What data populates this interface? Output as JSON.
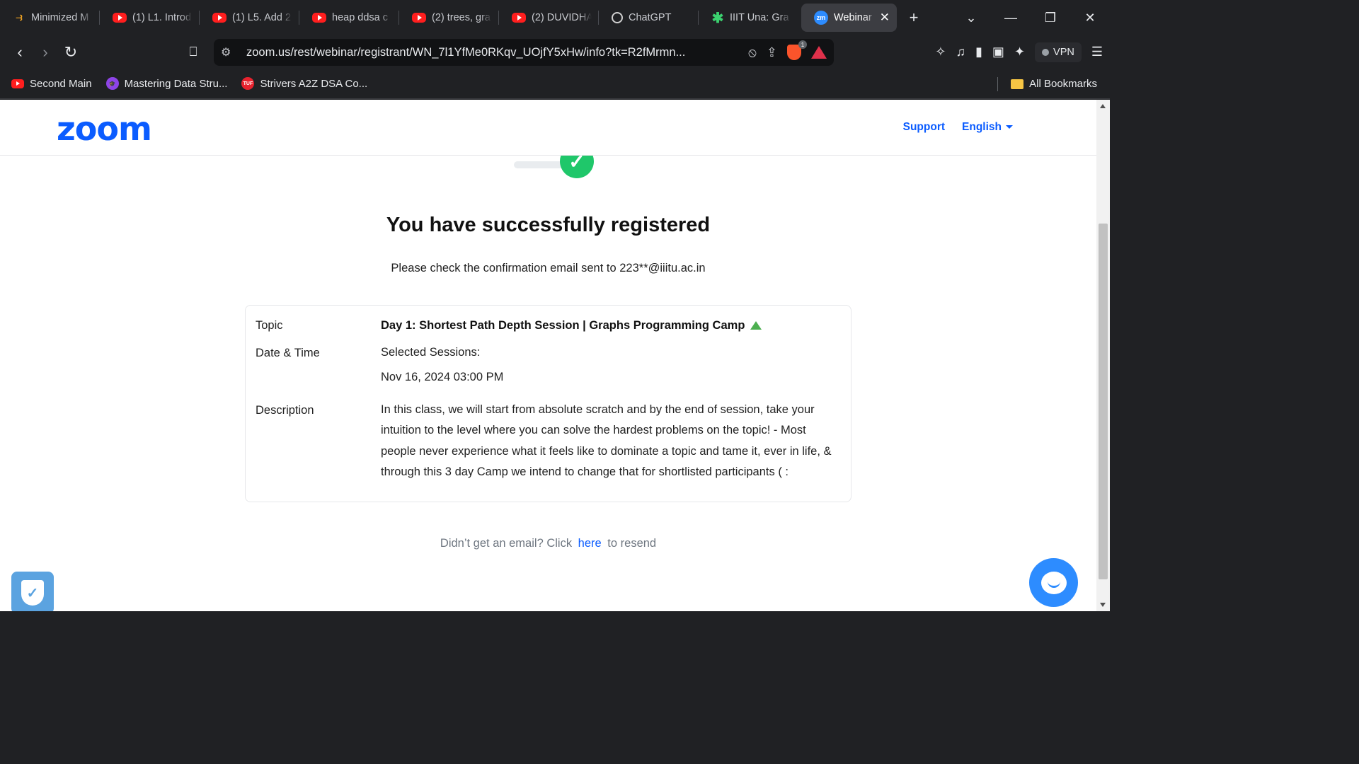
{
  "tabs": [
    {
      "icon": "mini",
      "title": "Minimized M"
    },
    {
      "icon": "youtube",
      "title": "(1) L1. Introd"
    },
    {
      "icon": "youtube",
      "title": "(1) L5. Add 2"
    },
    {
      "icon": "youtube",
      "title": "heap ddsa c"
    },
    {
      "icon": "youtube",
      "title": "(2) trees, gra"
    },
    {
      "icon": "youtube",
      "title": "(2) DUVIDHA"
    },
    {
      "icon": "chatgpt",
      "title": "ChatGPT"
    },
    {
      "icon": "star",
      "title": "IIIT Una: Gra"
    },
    {
      "icon": "zoom",
      "title": "Webinar",
      "active": true
    }
  ],
  "zoom_favicon_text": "zm",
  "address_bar": {
    "url": "zoom.us/rest/webinar/registrant/WN_7l1YfMe0RKqv_UOjfY5xHw/info?tk=R2fMrmn...",
    "brave_badge": "1"
  },
  "vpn_label": "VPN",
  "bookmarks": [
    {
      "icon": "youtube",
      "label": "Second Main"
    },
    {
      "icon": "purple",
      "label": "Mastering Data Stru..."
    },
    {
      "icon": "tuf",
      "label": "Strivers A2Z DSA Co...",
      "icon_text": "TUF"
    }
  ],
  "bookmarks_right": "All Bookmarks",
  "header": {
    "logo": "zoom",
    "support": "Support",
    "language": "English"
  },
  "registration": {
    "headline": "You have successfully registered",
    "confirmation": "Please check the confirmation email sent to 223**@iiitu.ac.in",
    "topic_label": "Topic",
    "topic_value": "Day 1: Shortest Path Depth Session | Graphs Programming Camp",
    "datetime_label": "Date & Time",
    "sessions_label": "Selected Sessions:",
    "session_datetime": "Nov 16, 2024 03:00 PM",
    "description_label": "Description",
    "description_value": "In this class, we will start from absolute scratch and by the end of session, take your intuition to the level where you can solve the hardest problems on the topic! - Most people never experience what it feels like to dominate a topic and tame it, ever in life, & through this 3 day Camp we intend to change that for shortlisted participants ( :"
  },
  "resend": {
    "prefix": "Didn’t get an email? Click",
    "link": "here",
    "suffix": "to resend"
  },
  "colors": {
    "zoom_blue": "#0b5cff",
    "success_green": "#1fc76a",
    "chat_blue": "#2d8cff"
  }
}
